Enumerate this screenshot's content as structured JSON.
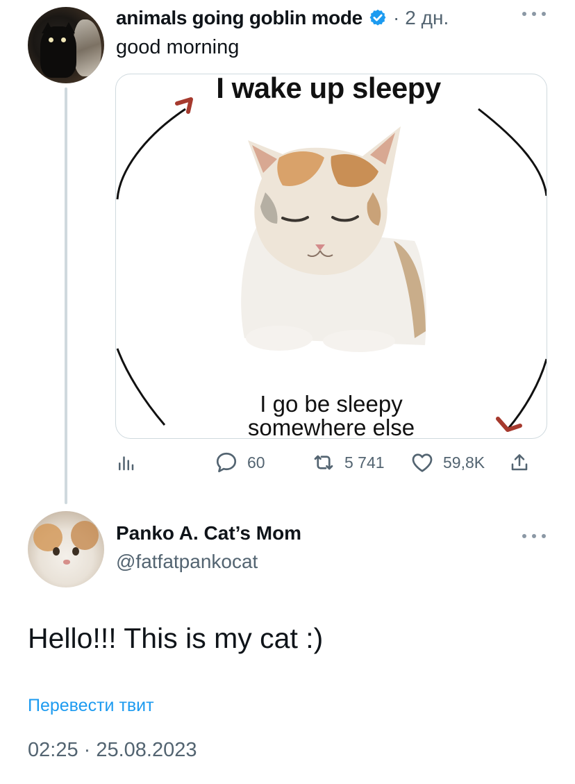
{
  "tweet": {
    "author_name": "animals going goblin mode",
    "separator": "·",
    "time_ago": "2 дн.",
    "text": "good morning",
    "media": {
      "top_caption": "I wake up sleepy",
      "bottom_caption_line1": "I go be sleepy",
      "bottom_caption_line2": "somewhere else"
    },
    "actions": {
      "replies": "60",
      "retweets": "5 741",
      "likes": "59,8K"
    }
  },
  "reply": {
    "author_name": "Panko A. Cat’s Mom",
    "handle": "@fatfatpankocat",
    "text": "Hello!!! This is my cat :)",
    "translate_label": "Перевести твит",
    "timestamp": "02:25 · 25.08.2023"
  },
  "colors": {
    "accent": "#1d9bf0",
    "secondary_text": "#536471",
    "primary_text": "#0f1419",
    "border": "#cfd9de",
    "meme_arrow_red": "#a63a2e"
  },
  "icons": {
    "verified": "verified-badge-icon",
    "more": "more-horizontal-icon",
    "analytics": "analytics-icon",
    "reply": "reply-icon",
    "retweet": "retweet-icon",
    "like": "heart-icon",
    "share": "share-icon"
  }
}
